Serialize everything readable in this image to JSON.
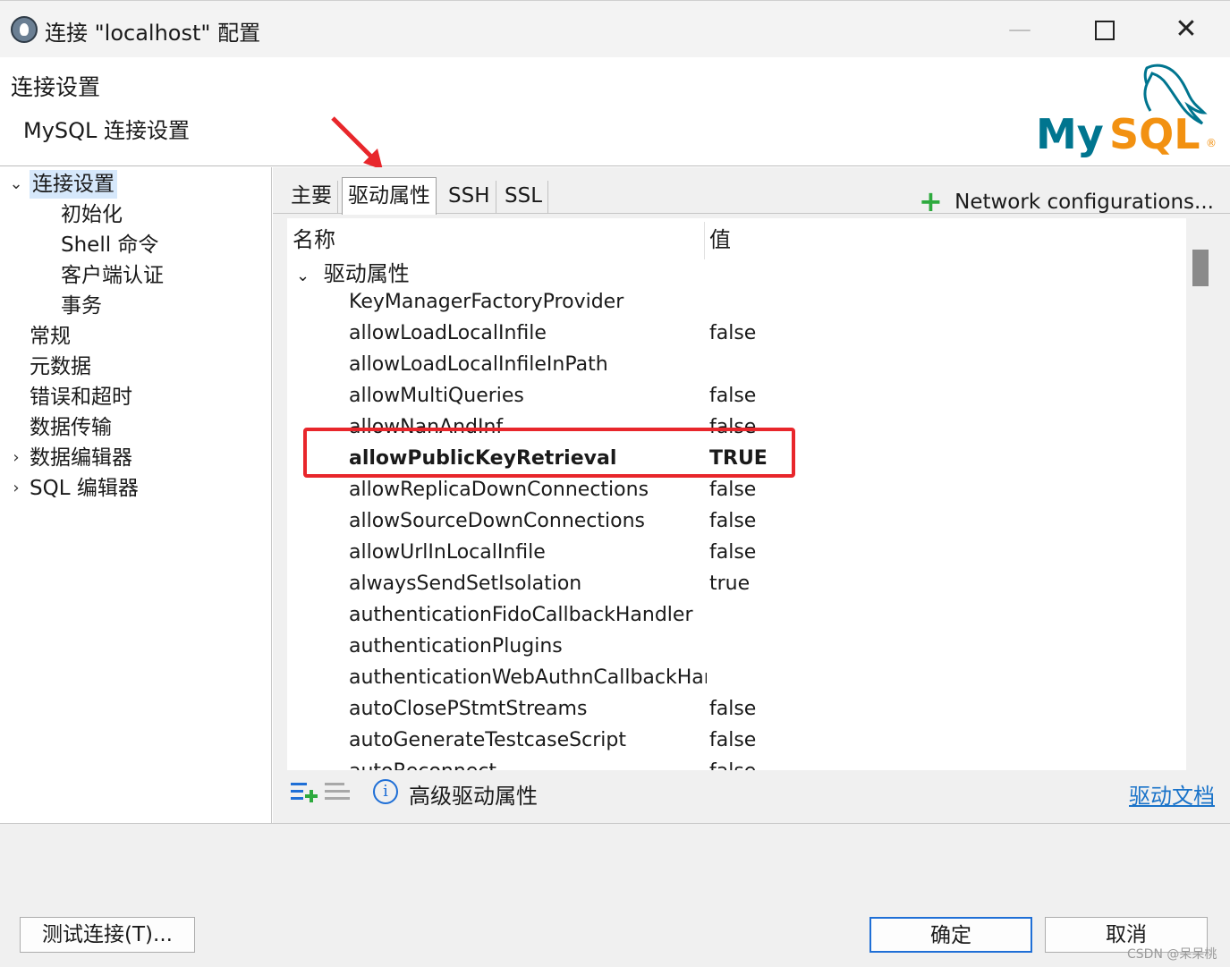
{
  "window": {
    "title": "连接 \"localhost\" 配置",
    "minimize": "—",
    "close": "✕"
  },
  "header": {
    "title": "连接设置",
    "subtitle": "MySQL 连接设置",
    "logo_text": "MySQL",
    "logo_mark": "®"
  },
  "sidebar": {
    "items": [
      {
        "label": "连接设置",
        "level": 0,
        "expander": "⌄",
        "selected": true
      },
      {
        "label": "初始化",
        "level": 1
      },
      {
        "label": "Shell 命令",
        "level": 1
      },
      {
        "label": "客户端认证",
        "level": 1
      },
      {
        "label": "事务",
        "level": 1
      },
      {
        "label": "常规",
        "level": 0
      },
      {
        "label": "元数据",
        "level": 0
      },
      {
        "label": "错误和超时",
        "level": 0
      },
      {
        "label": "数据传输",
        "level": 0
      },
      {
        "label": "数据编辑器",
        "level": 0,
        "expander": "›"
      },
      {
        "label": "SQL 编辑器",
        "level": 0,
        "expander": "›"
      }
    ]
  },
  "tabs": [
    {
      "label": "主要",
      "active": false
    },
    {
      "label": "驱动属性",
      "active": true
    },
    {
      "label": "SSH",
      "active": false
    },
    {
      "label": "SSL",
      "active": false
    }
  ],
  "network_config": {
    "icon": "+",
    "label": "Network configurations..."
  },
  "table": {
    "col_name": "名称",
    "col_value": "值",
    "group": {
      "label": "驱动属性",
      "chevron": "⌄"
    },
    "rows": [
      {
        "name": "KeyManagerFactoryProvider",
        "value": ""
      },
      {
        "name": "allowLoadLocalInfile",
        "value": "false"
      },
      {
        "name": "allowLoadLocalInfileInPath",
        "value": ""
      },
      {
        "name": "allowMultiQueries",
        "value": "false"
      },
      {
        "name": "allowNanAndInf",
        "value": "false"
      },
      {
        "name": "allowPublicKeyRetrieval",
        "value": "TRUE",
        "bold": true
      },
      {
        "name": "allowReplicaDownConnections",
        "value": "false"
      },
      {
        "name": "allowSourceDownConnections",
        "value": "false"
      },
      {
        "name": "allowUrlInLocalInfile",
        "value": "false"
      },
      {
        "name": "alwaysSendSetIsolation",
        "value": "true"
      },
      {
        "name": "authenticationFidoCallbackHandler",
        "value": ""
      },
      {
        "name": "authenticationPlugins",
        "value": ""
      },
      {
        "name": "authenticationWebAuthnCallbackHandler",
        "value": ""
      },
      {
        "name": "autoClosePStmtStreams",
        "value": "false"
      },
      {
        "name": "autoGenerateTestcaseScript",
        "value": "false"
      },
      {
        "name": "autoReconnect",
        "value": "false"
      }
    ]
  },
  "bottom_tools": {
    "info_icon": "i",
    "advanced_label": "高级驱动属性",
    "doc_link": "驱动文档"
  },
  "footer": {
    "test_button": "测试连接(T)...",
    "ok_button": "确定",
    "cancel_button": "取消",
    "watermark": "CSDN @呆呆桃"
  },
  "colors": {
    "accent": "#1f6fd6",
    "highlight": "#e8262b",
    "add_green": "#2eaa3e",
    "logo_blue": "#00758f",
    "logo_orange": "#f29111"
  }
}
